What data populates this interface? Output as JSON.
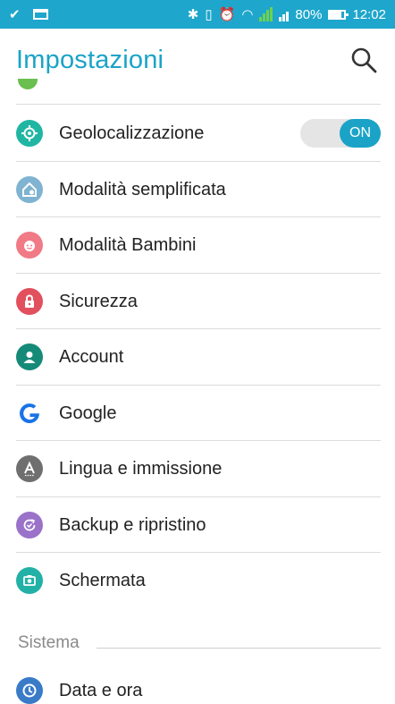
{
  "status_bar": {
    "battery": "80%",
    "time": "12:02"
  },
  "app_bar": {
    "title": "Impostazioni"
  },
  "settings": {
    "items": [
      {
        "label": "Geolocalizzazione",
        "icon": "location-crosshair-icon",
        "color": "#20b6a3"
      },
      {
        "label": "Modalità semplificata",
        "icon": "easy-mode-icon",
        "color": "#7fb3d1"
      },
      {
        "label": "Modalità Bambini",
        "icon": "kids-mode-icon",
        "color": "#f07a86"
      },
      {
        "label": "Sicurezza",
        "icon": "lock-icon",
        "color": "#e2505d"
      },
      {
        "label": "Account",
        "icon": "account-icon",
        "color": "#168a78"
      },
      {
        "label": "Google",
        "icon": "google-icon",
        "color": "#1a73e8"
      },
      {
        "label": "Lingua e immissione",
        "icon": "language-input-icon",
        "color": "#6f6f6f"
      },
      {
        "label": "Backup e ripristino",
        "icon": "backup-icon",
        "color": "#9a72c9"
      },
      {
        "label": "Schermata",
        "icon": "screenshot-icon",
        "color": "#22b1a6"
      }
    ],
    "geolocation_toggle": "ON"
  },
  "system_section": {
    "title": "Sistema",
    "items": [
      {
        "label": "Data e ora",
        "icon": "clock-icon",
        "color": "#3a7bc8"
      }
    ]
  },
  "colors": {
    "accent": "#1aa3c7",
    "status_bar": "#1ea6cc"
  }
}
